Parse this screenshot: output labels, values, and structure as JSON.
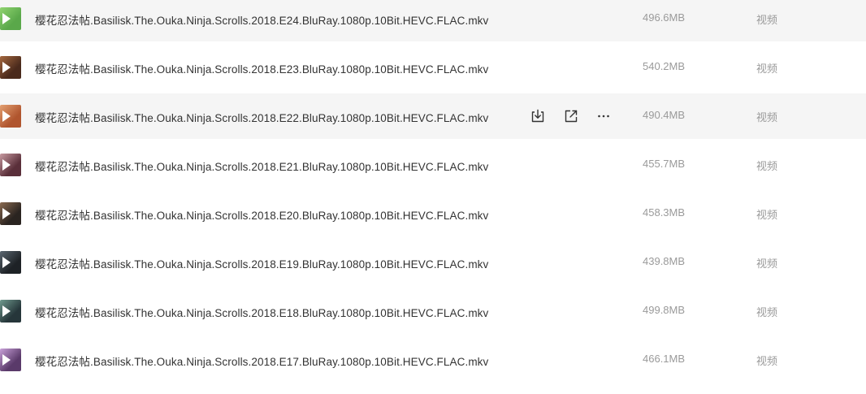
{
  "files": [
    {
      "name": "樱花忍法帖.Basilisk.The.Ouka.Ninja.Scrolls.2018.E24.BluRay.1080p.10Bit.HEVC.FLAC.mkv",
      "size": "496.6MB",
      "type": "视频",
      "thumb_color": "#5aa84a",
      "thumb_color2": "#8fd36f"
    },
    {
      "name": "樱花忍法帖.Basilisk.The.Ouka.Ninja.Scrolls.2018.E23.BluRay.1080p.10Bit.HEVC.FLAC.mkv",
      "size": "540.2MB",
      "type": "视频",
      "thumb_color": "#4a2a1c",
      "thumb_color2": "#a5683f"
    },
    {
      "name": "樱花忍法帖.Basilisk.The.Ouka.Ninja.Scrolls.2018.E22.BluRay.1080p.10Bit.HEVC.FLAC.mkv",
      "size": "490.4MB",
      "type": "视频",
      "thumb_color": "#b0552e",
      "thumb_color2": "#e3a071"
    },
    {
      "name": "樱花忍法帖.Basilisk.The.Ouka.Ninja.Scrolls.2018.E21.BluRay.1080p.10Bit.HEVC.FLAC.mkv",
      "size": "455.7MB",
      "type": "视频",
      "thumb_color": "#5a2f3a",
      "thumb_color2": "#c79aa0"
    },
    {
      "name": "樱花忍法帖.Basilisk.The.Ouka.Ninja.Scrolls.2018.E20.BluRay.1080p.10Bit.HEVC.FLAC.mkv",
      "size": "458.3MB",
      "type": "视频",
      "thumb_color": "#2a2420",
      "thumb_color2": "#8a6a50"
    },
    {
      "name": "樱花忍法帖.Basilisk.The.Ouka.Ninja.Scrolls.2018.E19.BluRay.1080p.10Bit.HEVC.FLAC.mkv",
      "size": "439.8MB",
      "type": "视频",
      "thumb_color": "#1e2226",
      "thumb_color2": "#5a6670"
    },
    {
      "name": "樱花忍法帖.Basilisk.The.Ouka.Ninja.Scrolls.2018.E18.BluRay.1080p.10Bit.HEVC.FLAC.mkv",
      "size": "499.8MB",
      "type": "视频",
      "thumb_color": "#26363a",
      "thumb_color2": "#6f9a8e"
    },
    {
      "name": "樱花忍法帖.Basilisk.The.Ouka.Ninja.Scrolls.2018.E17.BluRay.1080p.10Bit.HEVC.FLAC.mkv",
      "size": "466.1MB",
      "type": "视频",
      "thumb_color": "#5a3a6a",
      "thumb_color2": "#c8a0d8"
    }
  ],
  "hover_row_index": 2,
  "row_actions": {
    "download_icon": "download-icon",
    "share_icon": "share-icon",
    "more_icon": "more-icon"
  },
  "colors": {
    "hover_bg": "#f5f5f5",
    "name_text": "#333333",
    "meta_text": "#9a9a9a",
    "icon": "#333333"
  }
}
